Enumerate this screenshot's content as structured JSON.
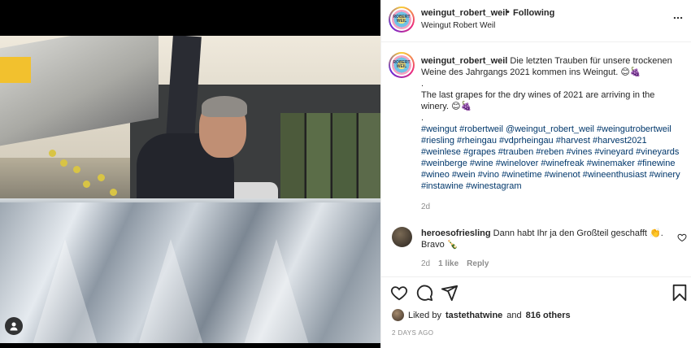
{
  "post": {
    "image_alt": "Man pouring grapes into a stainless steel bin"
  },
  "header": {
    "username": "weingut_robert_weil",
    "dot": "•",
    "follow_status": "Following",
    "subtitle": "Weingut Robert Weil",
    "more_icon": "more-horizontal-icon"
  },
  "caption": {
    "username": "weingut_robert_weil",
    "line1": "Die letzten Trauben für unsere trockenen Weine des Jahrgangs 2021 kommen ins Weingut. 😊🍇",
    "dot1": ".",
    "line2": "The last grapes for the dry wines of 2021 are arriving in the winery. 😊🍇",
    "dot2": ".",
    "hashtags": "#weingut #robertweil @weingut_robert_weil #weingutrobertweil #riesling #rheingau #vdprheingau #harvest #harvest2021 #weinlese #grapes #trauben #reben #vines #vineyard #vineyards #weinberge #wine #winelover #winefreak #winemaker #finewine #wineo #wein #vino #winetime #winenot #wineenthusiast #winery #instawine #winestagram",
    "time": "2d"
  },
  "comment": {
    "username": "heroesofriesling",
    "text": "Dann habt Ihr ja den Großteil geschafft 👏. Bravo 🍾",
    "time": "2d",
    "likes": "1 like",
    "reply": "Reply"
  },
  "actions": {
    "like_icon": "heart-icon",
    "comment_icon": "comment-icon",
    "share_icon": "share-icon",
    "save_icon": "bookmark-icon"
  },
  "likes": {
    "prefix": "Liked by",
    "user": "tastethatwine",
    "and": "and",
    "others": "816 others"
  },
  "posted": "2 DAYS AGO",
  "colors": {
    "link": "#00376b",
    "muted": "#8e8e8e",
    "text": "#262626",
    "border": "#efefef"
  }
}
